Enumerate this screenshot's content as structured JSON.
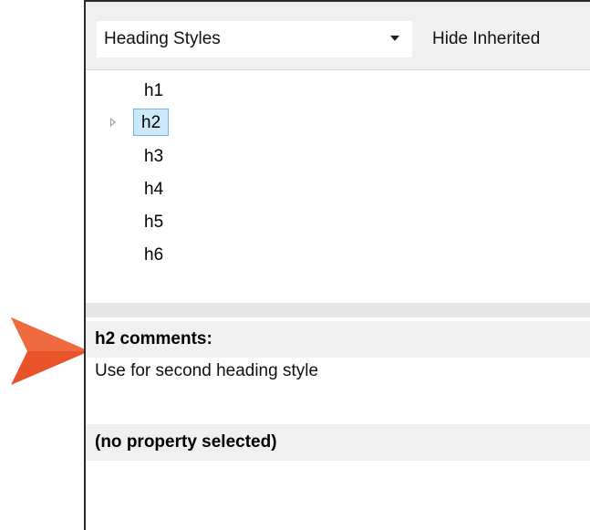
{
  "toolbar": {
    "dropdown_value": "Heading Styles",
    "hide_inherited_label": "Hide Inherited"
  },
  "tree": {
    "items": [
      {
        "label": "h1",
        "selected": false
      },
      {
        "label": "h2",
        "selected": true
      },
      {
        "label": "h3",
        "selected": false
      },
      {
        "label": "h4",
        "selected": false
      },
      {
        "label": "h5",
        "selected": false
      },
      {
        "label": "h6",
        "selected": false
      }
    ]
  },
  "comments": {
    "header": "h2 comments:",
    "text": "Use for second heading style"
  },
  "properties": {
    "header": "(no property selected)"
  },
  "colors": {
    "callout_arrow": "#e8532a",
    "selection_bg": "#cce8fb",
    "selection_border": "#6cb5e6"
  },
  "icons": {
    "expander": "triangle-right-icon",
    "dropdown_caret": "chevron-down-icon",
    "callout": "arrow-pointer-icon"
  }
}
